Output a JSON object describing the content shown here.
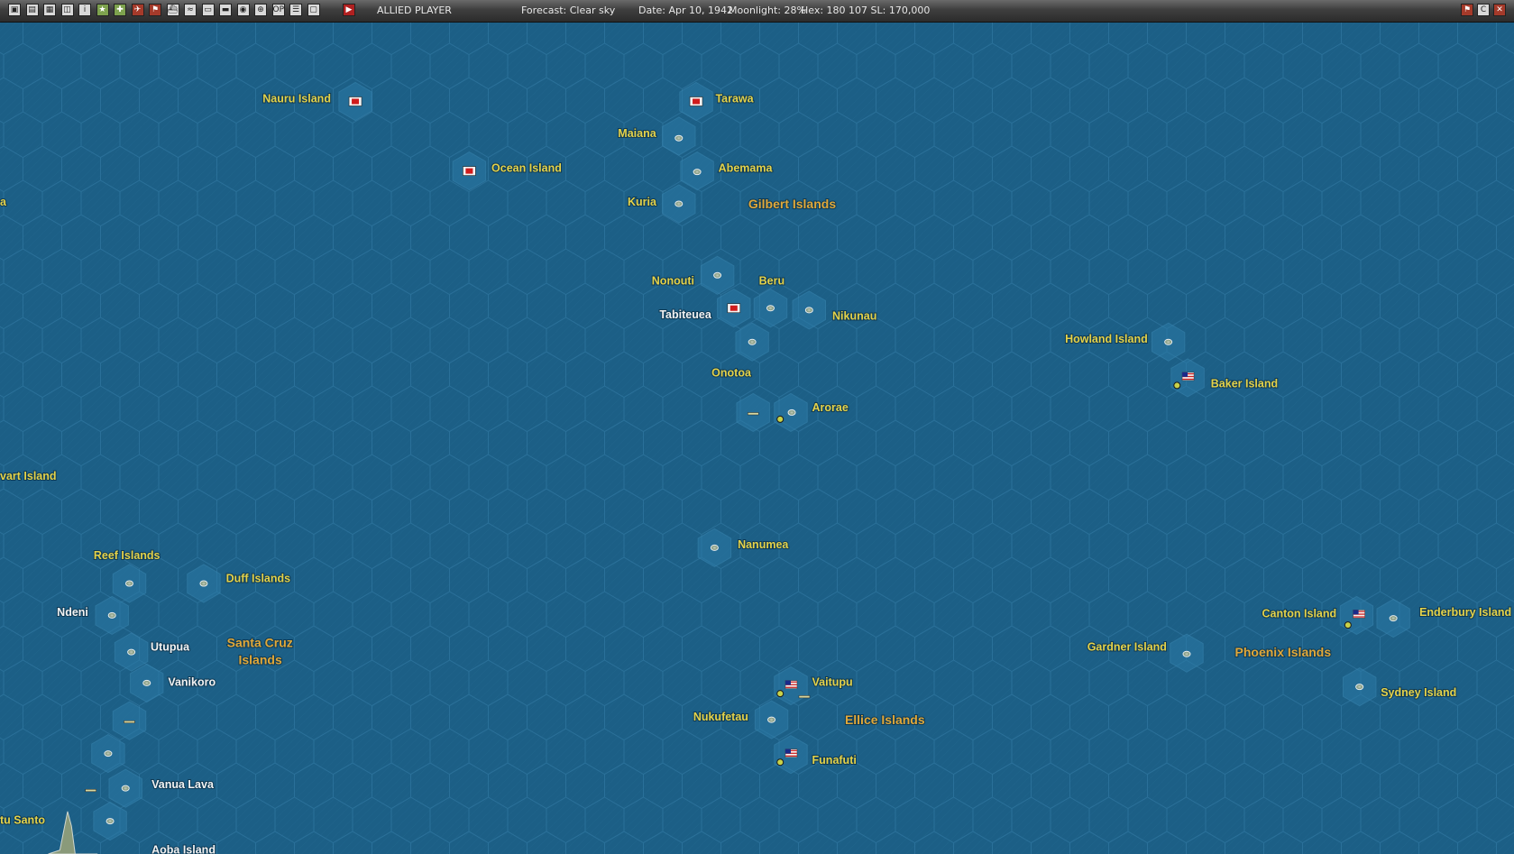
{
  "topbar": {
    "buttons": [
      "save-icon",
      "report-icon",
      "map-icon",
      "reset-icon",
      "info-icon",
      "star-icon",
      "air-icon",
      "plane-icon",
      "flag-icon",
      "ship-icon",
      "sub-icon",
      "cargo-icon",
      "train-icon",
      "globe-icon",
      "target-icon",
      "op-icon",
      "list-icon",
      "camera-icon"
    ],
    "player": "ALLIED PLAYER",
    "forecast": "Forecast: Clear sky",
    "date": "Date: Apr 10, 1942",
    "moonlight": "Moonlight: 28%",
    "hex": "Hex: 180 107  SL: 170,000",
    "right_buttons": [
      "flag-toggle-icon",
      "copy-icon",
      "close-icon"
    ]
  },
  "colors": {
    "ocean": "#1c5f86",
    "label_yellow": "#e4d24a",
    "label_white": "#f2f2f2",
    "group_orange": "#e0a83a",
    "japan_red": "#d01c1c",
    "us_blue": "#1a2a8a"
  },
  "map": {
    "labels": [
      {
        "text": "Nauru Island",
        "style": "y"
      },
      {
        "text": "Tarawa",
        "style": "y"
      },
      {
        "text": "Maiana",
        "style": "y"
      },
      {
        "text": "Abemama",
        "style": "y"
      },
      {
        "text": "Ocean Island",
        "style": "y"
      },
      {
        "text": "Kuria",
        "style": "y"
      },
      {
        "text": "Gilbert Islands",
        "style": "grp"
      },
      {
        "text": "a",
        "style": "y"
      },
      {
        "text": "Nonouti",
        "style": "y"
      },
      {
        "text": "Beru",
        "style": "y"
      },
      {
        "text": "Tabiteuea",
        "style": "w"
      },
      {
        "text": "Nikunau",
        "style": "y"
      },
      {
        "text": "Howland Island",
        "style": "y"
      },
      {
        "text": "Baker Island",
        "style": "y"
      },
      {
        "text": "Onotoa",
        "style": "y"
      },
      {
        "text": "Arorae",
        "style": "y"
      },
      {
        "text": "vart Island",
        "style": "y"
      },
      {
        "text": "Nanumea",
        "style": "y"
      },
      {
        "text": "Reef Islands",
        "style": "y"
      },
      {
        "text": "Duff Islands",
        "style": "y"
      },
      {
        "text": "Ndeni",
        "style": "w"
      },
      {
        "text": "Utupua",
        "style": "w"
      },
      {
        "text": "Santa Cruz",
        "style": "grp"
      },
      {
        "text": "Islands",
        "style": "grp"
      },
      {
        "text": "Vanikoro",
        "style": "w"
      },
      {
        "text": "Canton Island",
        "style": "y"
      },
      {
        "text": "Enderbury Island",
        "style": "y"
      },
      {
        "text": "Gardner Island",
        "style": "y"
      },
      {
        "text": "Phoenix Islands",
        "style": "grp"
      },
      {
        "text": "Sydney Island",
        "style": "y"
      },
      {
        "text": "Vaitupu",
        "style": "y"
      },
      {
        "text": "Nukufetau",
        "style": "y"
      },
      {
        "text": "Ellice Islands",
        "style": "grp"
      },
      {
        "text": "Funafuti",
        "style": "y"
      },
      {
        "text": "Vanua Lava",
        "style": "w"
      },
      {
        "text": "tu Santo",
        "style": "y"
      },
      {
        "text": "Aoba Island",
        "style": "w"
      }
    ],
    "japanese_bases": [
      "Nauru Island",
      "Tarawa",
      "Ocean Island",
      "Tabiteuea"
    ],
    "allied_bases": [
      "Baker Island",
      "Canton Island",
      "Vaitupu",
      "Funafuti"
    ]
  }
}
